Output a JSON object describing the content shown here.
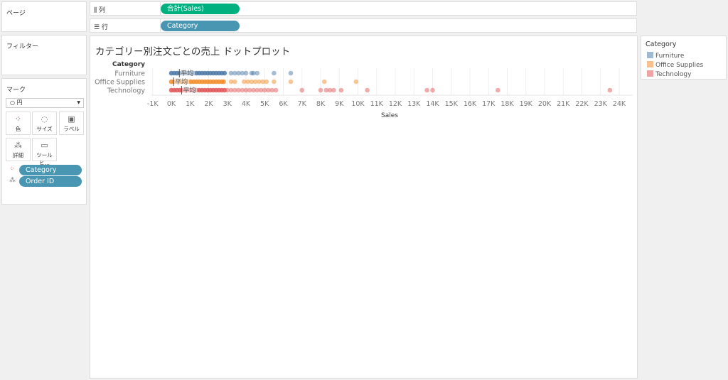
{
  "panels": {
    "pages": "ページ",
    "filters": "フィルター",
    "marks": "マーク"
  },
  "shelves": {
    "columns_label": "列",
    "columns_pill": "合計(Sales)",
    "rows_label": "行",
    "rows_pill": "Category"
  },
  "marks": {
    "type": "○ 円",
    "buttons": [
      {
        "label": "色",
        "icon": "color-dots-icon"
      },
      {
        "label": "サイズ",
        "icon": "size-icon"
      },
      {
        "label": "ラベル",
        "icon": "label-icon"
      },
      {
        "label": "詳細",
        "icon": "detail-icon"
      },
      {
        "label": "ツールヒ…",
        "icon": "tooltip-icon"
      }
    ],
    "fields": [
      {
        "label": "Category",
        "icon": "color-dots-icon"
      },
      {
        "label": "Order ID",
        "icon": "detail-icon"
      }
    ]
  },
  "colors": {
    "columns_pill": "#00b180",
    "rows_pill": "#4996b2",
    "Furniture": "#4e79a7",
    "Office Supplies": "#f28e2b",
    "Technology": "#e15759"
  },
  "legend": {
    "title": "Category",
    "items": [
      "Furniture",
      "Office Supplies",
      "Technology"
    ]
  },
  "chart_data": {
    "type": "scatter",
    "title": "カテゴリー別注文ごとの売上 ドットプロット",
    "row_header": "Category",
    "xlabel": "Sales",
    "xlim": [
      -1200,
      24700
    ],
    "x_ticks": [
      "-1K",
      "0K",
      "1K",
      "2K",
      "3K",
      "4K",
      "5K",
      "6K",
      "7K",
      "8K",
      "9K",
      "10K",
      "11K",
      "12K",
      "13K",
      "14K",
      "15K",
      "16K",
      "17K",
      "18K",
      "19K",
      "20K",
      "21K",
      "22K",
      "23K",
      "24K"
    ],
    "x_tick_values": [
      -1000,
      0,
      1000,
      2000,
      3000,
      4000,
      5000,
      6000,
      7000,
      8000,
      9000,
      10000,
      11000,
      12000,
      13000,
      14000,
      15000,
      16000,
      17000,
      18000,
      19000,
      20000,
      21000,
      22000,
      23000,
      24000
    ],
    "reference_label": "平均",
    "series": [
      {
        "name": "Furniture",
        "average": 430,
        "values": [
          0,
          150,
          300,
          450,
          600,
          750,
          900,
          1050,
          1200,
          1350,
          1500,
          1650,
          1800,
          1950,
          2100,
          2250,
          2400,
          2550,
          2700,
          2850,
          3200,
          3400,
          3600,
          3800,
          4000,
          4300,
          4400,
          4600,
          5500,
          6400
        ]
      },
      {
        "name": "Office Supplies",
        "average": 120,
        "values": [
          0,
          150,
          300,
          450,
          600,
          750,
          900,
          1050,
          1200,
          1350,
          1500,
          1650,
          1800,
          1950,
          2100,
          2250,
          2400,
          2550,
          2700,
          2800,
          3200,
          3400,
          3900,
          4100,
          4300,
          4500,
          4700,
          4900,
          5100,
          5500,
          6400,
          8200,
          9900
        ]
      },
      {
        "name": "Technology",
        "average": 550,
        "values": [
          0,
          150,
          300,
          450,
          600,
          750,
          900,
          1050,
          1200,
          1350,
          1500,
          1650,
          1800,
          1950,
          2100,
          2250,
          2400,
          2550,
          2700,
          2850,
          3000,
          3200,
          3400,
          3600,
          3800,
          4000,
          4200,
          4400,
          4600,
          4800,
          5000,
          5200,
          5400,
          5600,
          7000,
          8000,
          8300,
          8500,
          8700,
          9100,
          10500,
          13700,
          14000,
          17500,
          23500
        ]
      }
    ]
  }
}
